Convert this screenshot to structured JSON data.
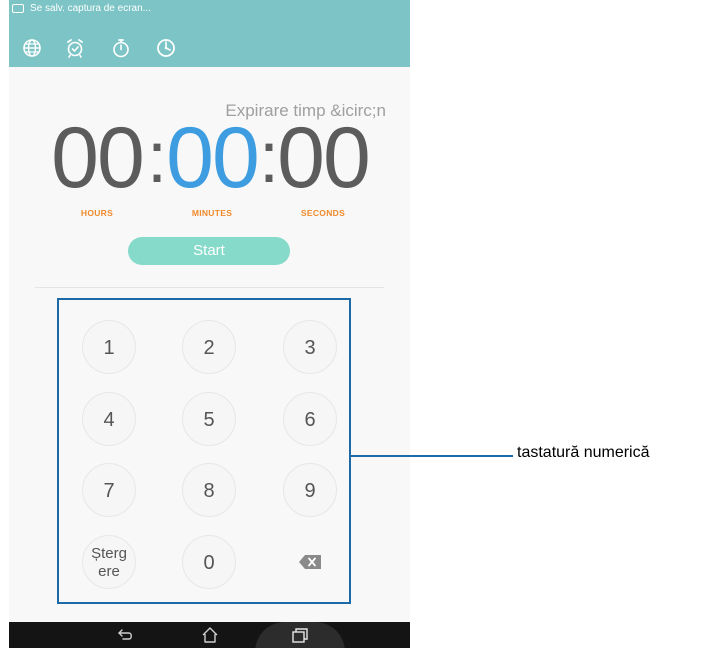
{
  "statusbar": {
    "notification_icon": "screenshot-icon",
    "notification_text": "Se salv. captura de ecran..."
  },
  "tabs": [
    {
      "icon": "globe-icon"
    },
    {
      "icon": "alarm-clock-icon"
    },
    {
      "icon": "stopwatch-icon"
    },
    {
      "icon": "timer-icon"
    }
  ],
  "timer": {
    "expire_label": "Expirare timp &icirc;n",
    "hours": "00",
    "minutes": "00",
    "seconds": "00",
    "separator": ":",
    "hours_label": "HOURS",
    "minutes_label": "MINUTES",
    "seconds_label": "SECONDS"
  },
  "start_label": "Start",
  "keypad": {
    "keys": [
      "1",
      "2",
      "3",
      "4",
      "5",
      "6",
      "7",
      "8",
      "9"
    ],
    "erase_line1": "Șterg",
    "erase_line2": "ere",
    "zero": "0",
    "backspace_icon": "backspace-icon"
  },
  "navbar": {
    "back_icon": "back-icon",
    "home_icon": "home-icon",
    "recents_icon": "recents-icon"
  },
  "callout": {
    "label": "tastatură numerică"
  },
  "colors": {
    "header": "#7cc4c5",
    "accent_blue": "#3d9de0",
    "label_orange": "#f08a2c",
    "start_button": "#86dac9",
    "callout": "#1d6aa8"
  }
}
